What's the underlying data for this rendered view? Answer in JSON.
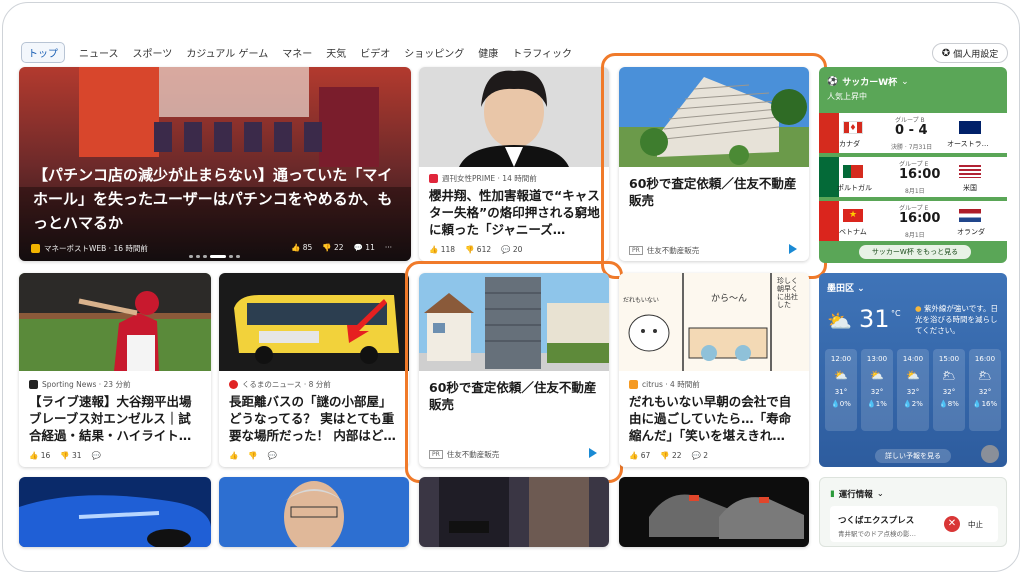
{
  "nav": {
    "tabs": [
      "トップ",
      "ニュース",
      "スポーツ",
      "カジュアル ゲーム",
      "マネー",
      "天気",
      "ビデオ",
      "ショッピング",
      "健康",
      "トラフィック"
    ],
    "personal_label": "個人用設定"
  },
  "hero": {
    "title": "【パチンコ店の減少が止まらない】通っていた「マイホール」を失ったユーザーはパチンコをやめるか、もっとハマるか",
    "source": "マネーポストWEB · 16 時間前",
    "likes": "85",
    "dislikes": "22",
    "comments": "11"
  },
  "card_sakurai": {
    "source": "週刊女性PRIME · 14 時間前",
    "title": "櫻井翔、性加害報道で“キャスター失格”の烙印押される窮地に頼った「ジャニーズ…",
    "likes": "118",
    "dislikes": "612",
    "comments": "20"
  },
  "ad_top": {
    "title": "60秒で査定依頼／住友不動産販売",
    "sponsor": "住友不動産販売",
    "pr": "PR"
  },
  "ad_mid": {
    "title": "60秒で査定依頼／住友不動産販売",
    "sponsor": "住友不動産販売",
    "pr": "PR"
  },
  "card_ohtani": {
    "source": "Sporting News · 23 分前",
    "title": "【ライブ速報】大谷翔平出場 ブレーブス対エンゼルス｜試合経過・結果・ハイライト…",
    "likes": "16",
    "dislikes": "31"
  },
  "card_bus": {
    "source": "くるまのニュース · 8 分前",
    "title": "長距離バスの「謎の小部屋」どうなってる？ 実はとても重要な場所だった！ 内部はど…"
  },
  "card_citrus": {
    "source": "citrus · 4 時間前",
    "title": "だれもいない早朝の会社で自由に過ごしていたら…「寿命縮んだ」「笑いを堪えきれ…",
    "likes": "67",
    "dislikes": "22",
    "comments": "2",
    "comic_texts": [
      "だれもいない",
      "から〜ん",
      "珍しく朝早くに出社した"
    ]
  },
  "soccer": {
    "title": "サッカーW杯",
    "subtitle": "人気上昇中",
    "matches": [
      {
        "group": "グループ B",
        "home": "カナダ",
        "away": "オーストラ…",
        "score": "0 - 4",
        "status": "決勝 · 7月31日",
        "home_color": "#d52b1e",
        "away_color": "#012169"
      },
      {
        "group": "グループ E",
        "home": "ポルトガル",
        "away": "米国",
        "score": "16:00",
        "status": "8月1日",
        "home_color": "#046a38",
        "away_color": "#1a2b6d"
      },
      {
        "group": "グループ E",
        "home": "ベトナム",
        "away": "オランダ",
        "score": "16:00",
        "status": "8月1日",
        "home_color": "#da251d",
        "away_color": "#ae1c28"
      }
    ],
    "more_label": "サッカーW杯 をもっと見る"
  },
  "weather": {
    "location": "墨田区",
    "temp": "31",
    "unit": "°C",
    "alert": "紫外線が強いです。日光を浴びる時間を減らしてください。",
    "hours": [
      {
        "time": "12:00",
        "temp": "31°",
        "precip": "0%"
      },
      {
        "time": "13:00",
        "temp": "32°",
        "precip": "1%"
      },
      {
        "time": "14:00",
        "temp": "32°",
        "precip": "2%"
      },
      {
        "time": "15:00",
        "temp": "32°",
        "precip": "8%"
      },
      {
        "time": "16:00",
        "temp": "32°",
        "precip": "16%"
      }
    ],
    "detail_label": "詳しい予報を見る"
  },
  "traffic": {
    "title": "運行情報",
    "line": "つくばエクスプレス",
    "detail": "青井駅でのドア点検の影…",
    "status": "中止"
  }
}
